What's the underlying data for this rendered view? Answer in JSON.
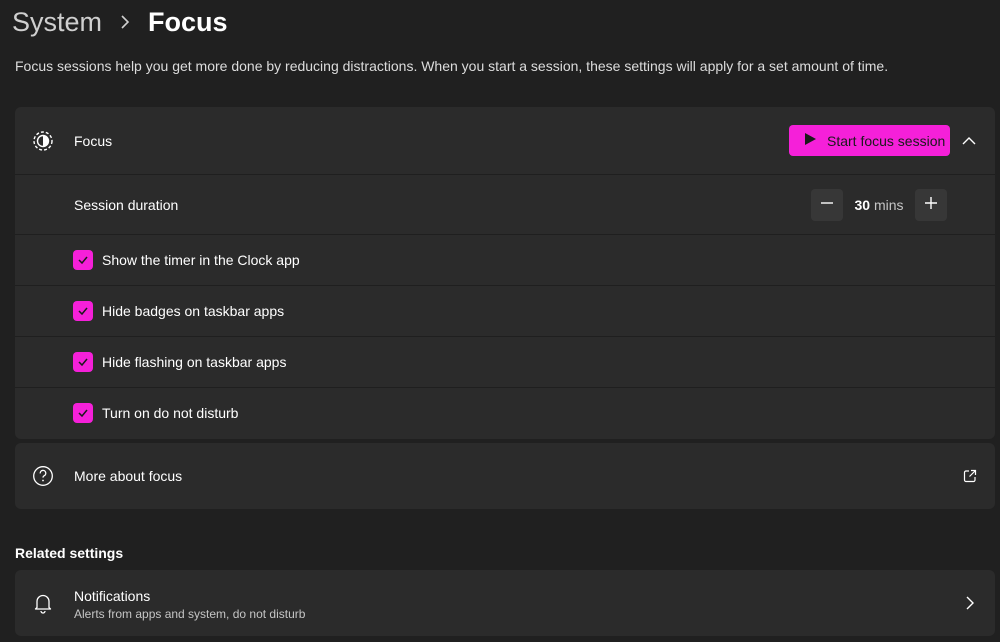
{
  "breadcrumb": {
    "parent": "System",
    "current": "Focus"
  },
  "description": "Focus sessions help you get more done by reducing distractions. When you start a session, these settings will apply for a set amount of time.",
  "focus_card": {
    "title": "Focus",
    "start_button_label": "Start focus session",
    "session_duration": {
      "label": "Session duration",
      "value": "30",
      "unit": "mins"
    },
    "options": [
      {
        "label": "Show the timer in the Clock app",
        "checked": true
      },
      {
        "label": "Hide badges on taskbar apps",
        "checked": true
      },
      {
        "label": "Hide flashing on taskbar apps",
        "checked": true
      },
      {
        "label": "Turn on do not disturb",
        "checked": true
      }
    ]
  },
  "more_about": {
    "label": "More about focus"
  },
  "related": {
    "title": "Related settings",
    "notifications": {
      "title": "Notifications",
      "subtitle": "Alerts from apps and system, do not disturb"
    }
  },
  "colors": {
    "accent": "#f520d9",
    "background": "#202020",
    "card": "#2b2b2b"
  }
}
